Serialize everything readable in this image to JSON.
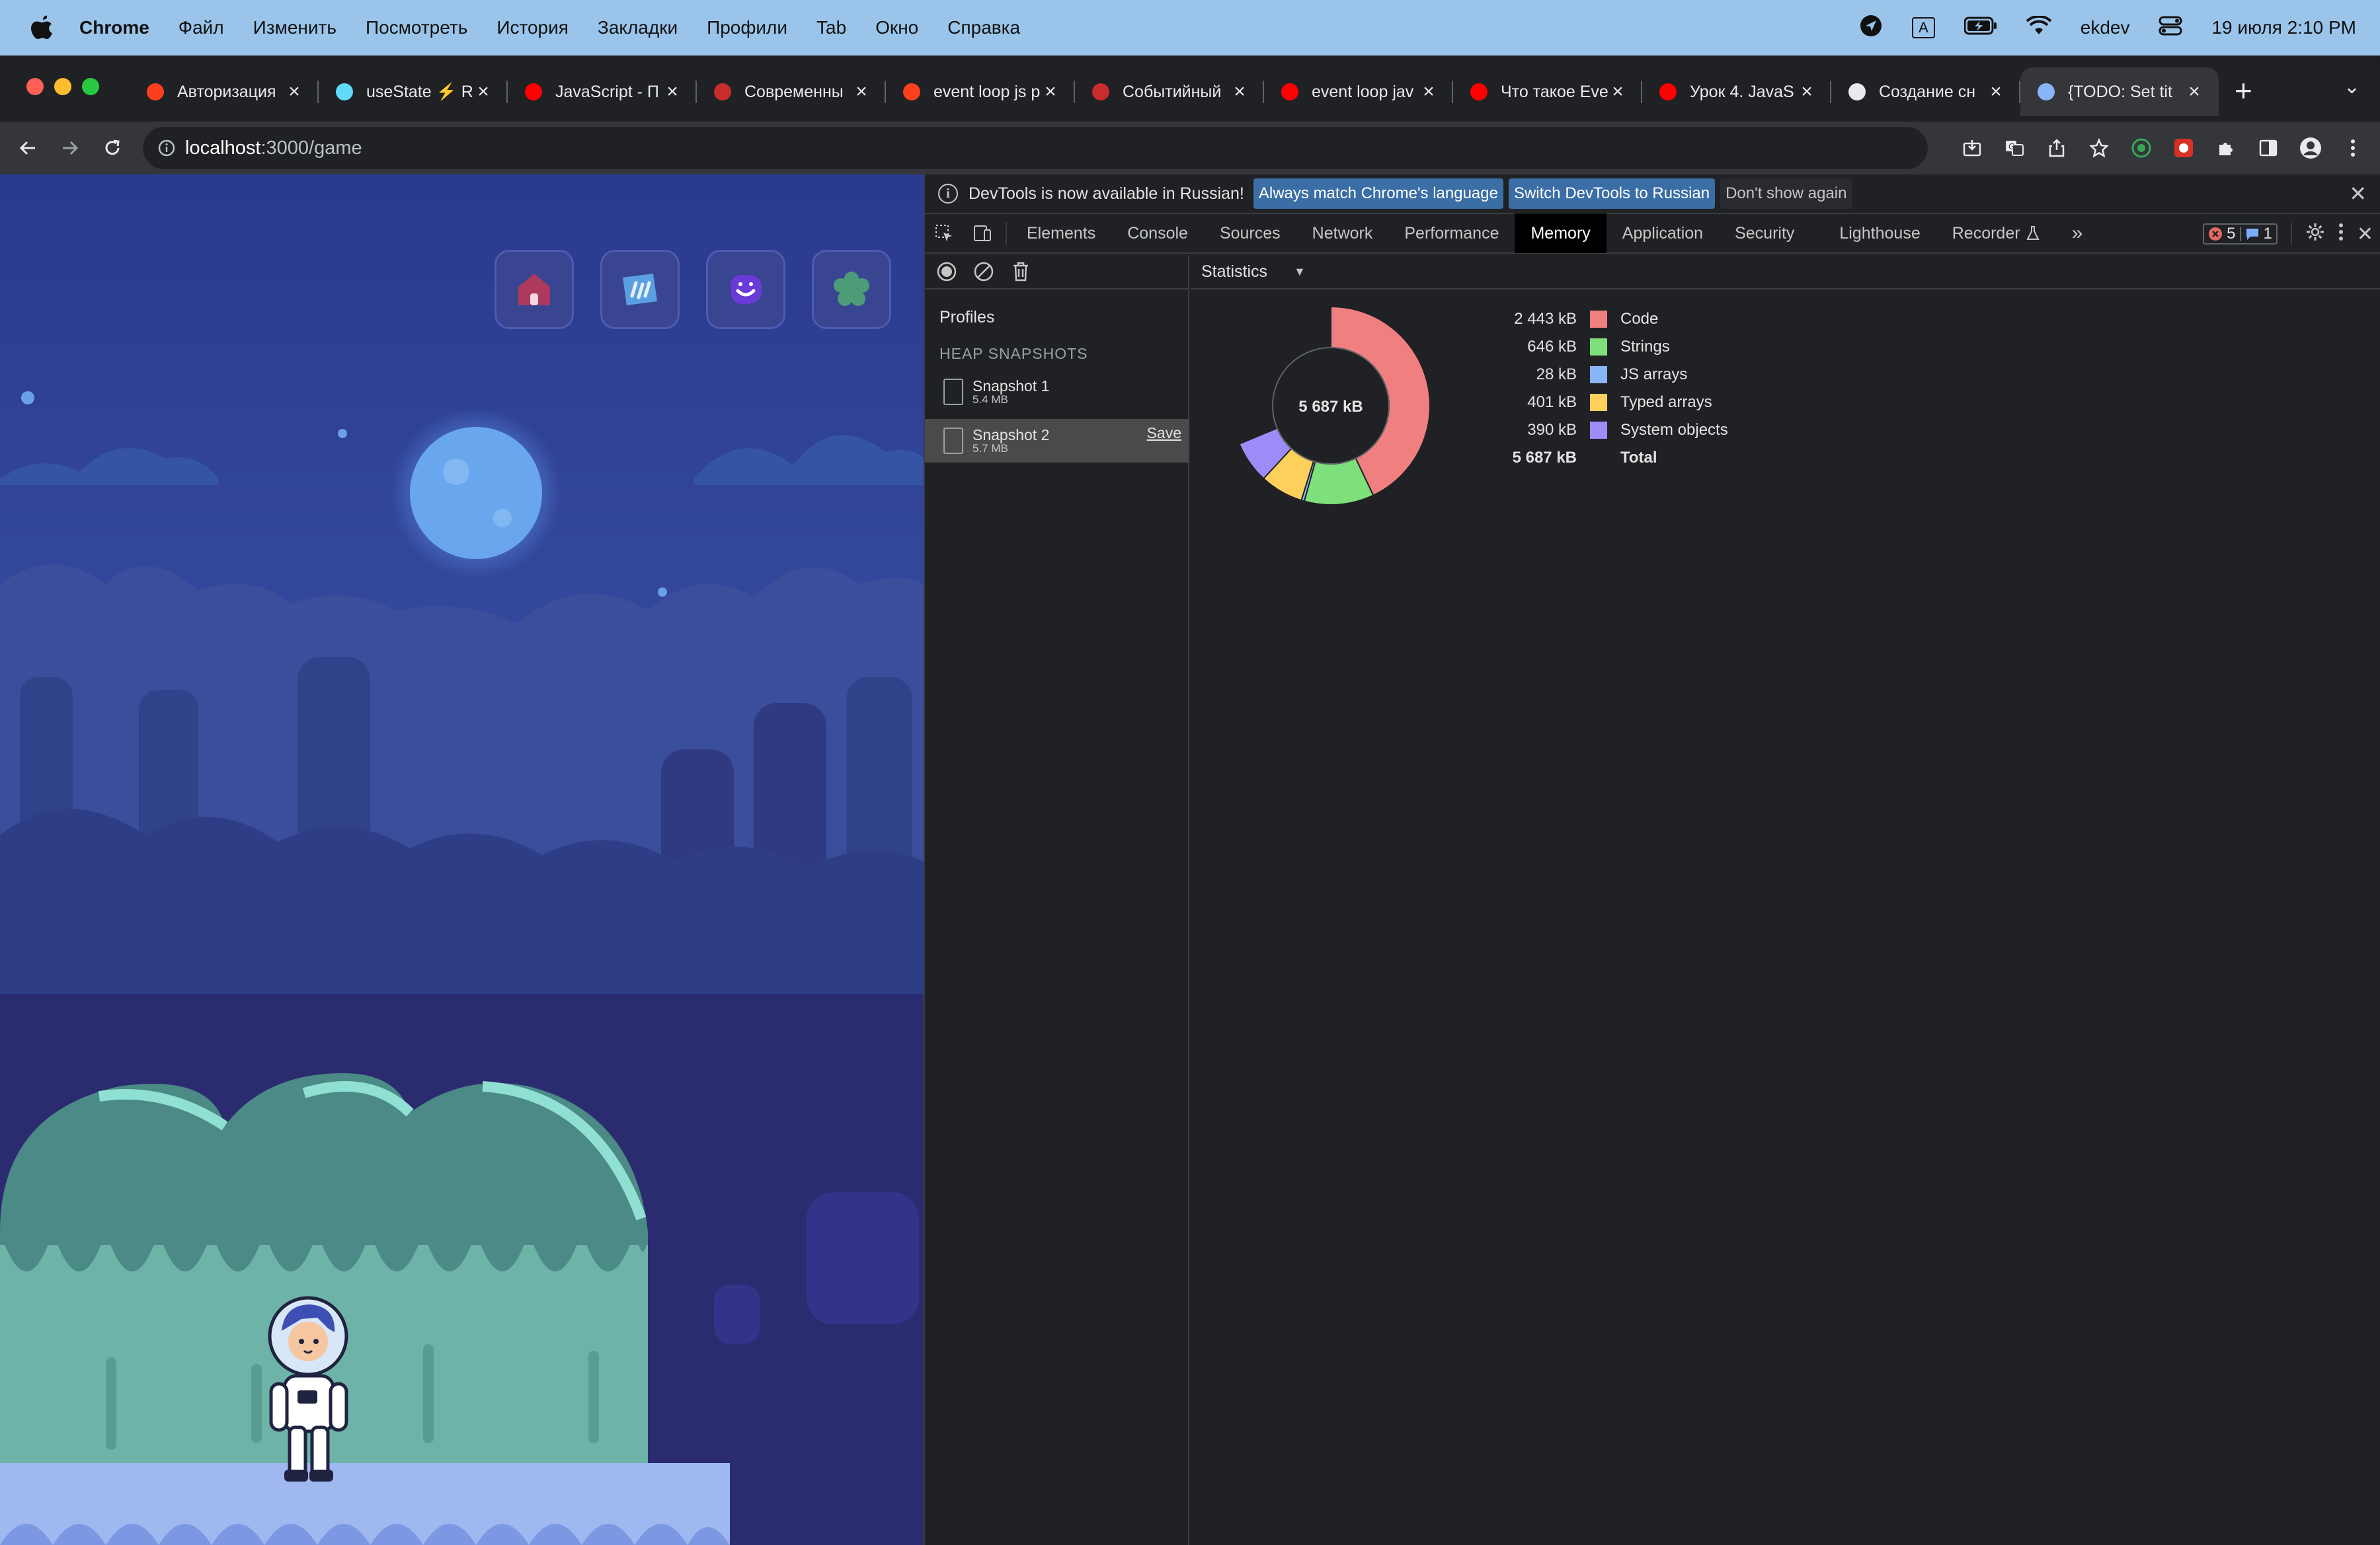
{
  "menubar": {
    "app_name": "Chrome",
    "items": [
      "Файл",
      "Изменить",
      "Посмотреть",
      "История",
      "Закладки",
      "Профили",
      "Tab",
      "Окно",
      "Справка"
    ],
    "user": "ekdev",
    "datetime": "19 июля  2:10 PM",
    "input_indicator": "A"
  },
  "tabs": [
    {
      "title": "Авторизация",
      "favicon": "yandex-icon",
      "color": "#fc3f1d"
    },
    {
      "title": "useState ⚡ R",
      "favicon": "react-icon",
      "color": "#61dafb"
    },
    {
      "title": "JavaScript - П",
      "favicon": "youtube-icon",
      "color": "#ff0000"
    },
    {
      "title": "Современны",
      "favicon": "learnjs-icon",
      "color": "#c92c2c"
    },
    {
      "title": "event loop js р",
      "favicon": "yandex-icon",
      "color": "#fc3f1d"
    },
    {
      "title": "Событийный",
      "favicon": "learnjs-icon",
      "color": "#c92c2c"
    },
    {
      "title": "event loop jav",
      "favicon": "youtube-icon",
      "color": "#ff0000"
    },
    {
      "title": "Что такое Eve",
      "favicon": "youtube-icon",
      "color": "#ff0000"
    },
    {
      "title": "Урок 4. JavaS",
      "favicon": "youtube-icon",
      "color": "#ff0000"
    },
    {
      "title": "Создание сн",
      "favicon": "apple-icon",
      "color": "#e8eaed"
    },
    {
      "title": "{TODO: Set tit",
      "favicon": "app-icon",
      "color": "#8ab4f8",
      "active": true
    }
  ],
  "omnibox": {
    "host": "localhost",
    "path": ":3000/game"
  },
  "devtools": {
    "infobar": {
      "message": "DevTools is now available in Russian!",
      "btn_match": "Always match Chrome's language",
      "btn_switch": "Switch DevTools to Russian",
      "btn_dont_show": "Don't show again"
    },
    "tabs": [
      "Elements",
      "Console",
      "Sources",
      "Network",
      "Performance",
      "Memory",
      "Application",
      "Security",
      "Lighthouse",
      "Recorder"
    ],
    "active_tab": "Memory",
    "errors_count": "5",
    "messages_count": "1",
    "sidebar": {
      "profiles_title": "Profiles",
      "heap_title": "HEAP SNAPSHOTS",
      "snapshots": [
        {
          "name": "Snapshot 1",
          "size": "5.4 MB"
        },
        {
          "name": "Snapshot 2",
          "size": "5.7 MB",
          "selected": true,
          "action": "Save"
        }
      ]
    },
    "view_select": "Statistics",
    "chart_data": {
      "type": "pie",
      "center_label": "5 687 kB",
      "categories": [
        "Code",
        "Strings",
        "JS arrays",
        "Typed arrays",
        "System objects"
      ],
      "values": [
        2443,
        646,
        28,
        401,
        390
      ],
      "display_values": [
        "2 443 kB",
        "646 kB",
        "28 kB",
        "401 kB",
        "390 kB"
      ],
      "colors": [
        "#f08080",
        "#7ee07b",
        "#8ab4f8",
        "#fcd05b",
        "#9b8cf7"
      ],
      "other_value": 1779,
      "other_color": "#202124",
      "total_label": "Total",
      "total_display": "5 687 kB"
    }
  }
}
